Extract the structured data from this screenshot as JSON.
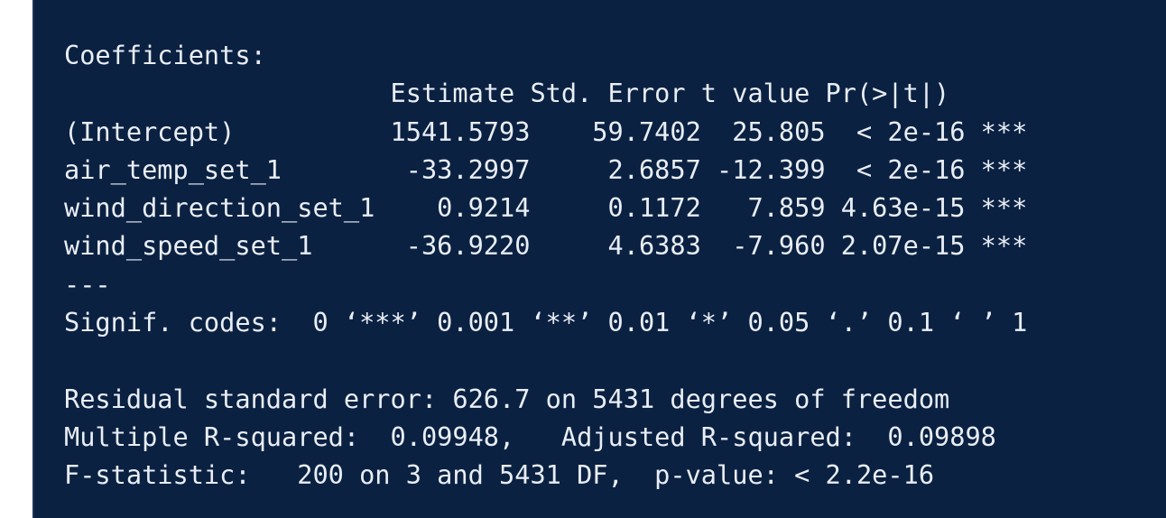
{
  "output": {
    "lines": [
      "Coefficients:",
      "                     Estimate Std. Error t value Pr(>|t|)    ",
      "(Intercept)          1541.5793    59.7402  25.805  < 2e-16 ***",
      "air_temp_set_1        -33.2997     2.6857 -12.399  < 2e-16 ***",
      "wind_direction_set_1    0.9214     0.1172   7.859 4.63e-15 ***",
      "wind_speed_set_1      -36.9220     4.6383  -7.960 2.07e-15 ***",
      "---",
      "Signif. codes:  0 ‘***’ 0.001 ‘**’ 0.01 ‘*’ 0.05 ‘.’ 0.1 ‘ ’ 1",
      "",
      "Residual standard error: 626.7 on 5431 degrees of freedom",
      "Multiple R-squared:  0.09948,   Adjusted R-squared:  0.09898 ",
      "F-statistic:   200 on 3 and 5431 DF,  p-value: < 2.2e-16"
    ]
  }
}
